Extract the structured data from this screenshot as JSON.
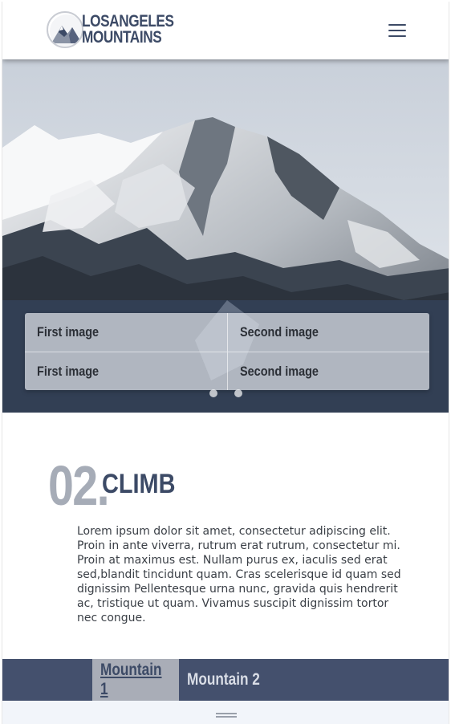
{
  "header": {
    "logo_line1": "LOSANGELES",
    "logo_line2": "MOUNTAINS",
    "menu_icon": "hamburger-menu-icon"
  },
  "slider": {
    "cells": [
      "First image",
      "Second image",
      "First image",
      "Second image"
    ],
    "dot_count": 2
  },
  "section": {
    "number": "02.",
    "title": "CLIMB",
    "body": "Lorem ipsum dolor sit amet, consectetur adipiscing elit. Proin in ante viverra, rutrum erat rutrum, consectetur mi. Proin at maximus est. Nullam purus ex, iaculis sed erat sed,blandit tincidunt quam. Cras scelerisque id quam sed dignissim Pellentesque urna nunc, gravida quis hendrerit ac, tristique ut quam. Vivamus suscipit dignissim tortor nec congue."
  },
  "tabs": {
    "items": [
      "Mountain 1",
      "Mountain 2"
    ],
    "active_index": 0
  },
  "colors": {
    "brand": "#3c4a66",
    "tab_bar": "#44506d",
    "number_gray": "#a6acb7"
  }
}
